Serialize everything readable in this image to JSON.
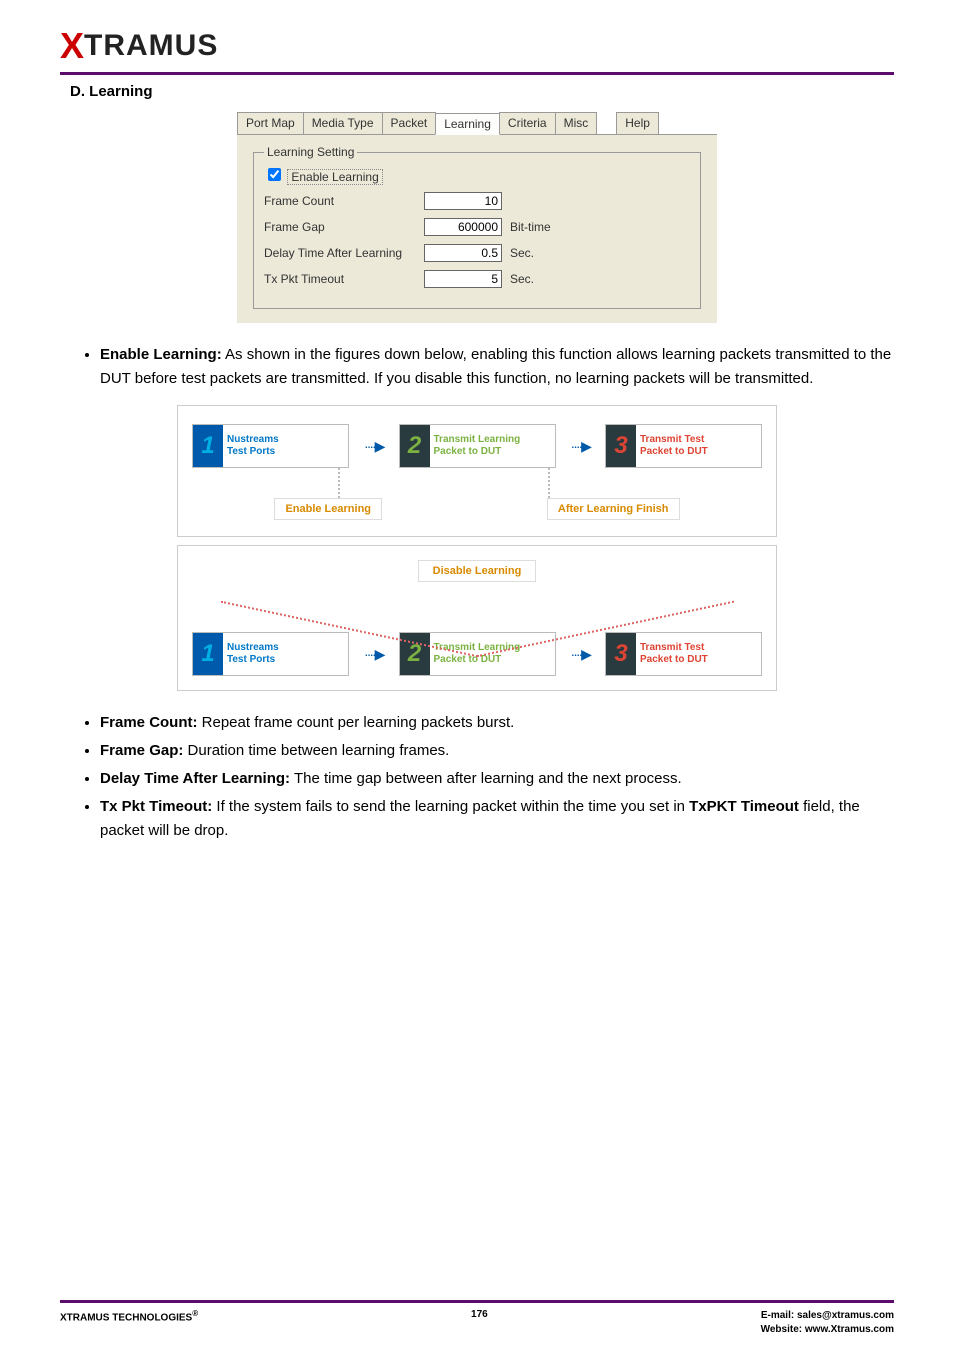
{
  "logo": {
    "x": "X",
    "rest": "TRAMUS"
  },
  "section_title": "D. Learning",
  "tabs": {
    "port_map": "Port Map",
    "media_type": "Media Type",
    "packet": "Packet",
    "learning": "Learning",
    "criteria": "Criteria",
    "misc": "Misc",
    "help": "Help"
  },
  "learning_panel": {
    "legend": "Learning Setting",
    "enable_learning_label": "Enable Learning",
    "frame_count_label": "Frame Count",
    "frame_count_value": "10",
    "frame_gap_label": "Frame Gap",
    "frame_gap_value": "600000",
    "frame_gap_unit": "Bit-time",
    "delay_label": "Delay Time After Learning",
    "delay_value": "0.5",
    "delay_unit": "Sec.",
    "tx_timeout_label": "Tx Pkt Timeout",
    "tx_timeout_value": "5",
    "tx_timeout_unit": "Sec."
  },
  "flow": {
    "box1_line1": "Nustreams",
    "box1_line2": "Test Ports",
    "box2_line1": "Transmit Learning",
    "box2_line2": "Packet to DUT",
    "box3_line1": "Transmit Test",
    "box3_line2": "Packet to DUT",
    "cap_enable": "Enable Learning",
    "cap_after": "After Learning Finish",
    "cap_disable": "Disable Learning",
    "arrow": "····▶",
    "n1": "1",
    "n2": "2",
    "n3": "3"
  },
  "bullets": {
    "b1_title": "Enable Learning:",
    "b1_text": " As shown in the figures down below, enabling this function allows learning packets transmitted to the DUT before test packets are transmitted. If you disable this function, no learning packets will be transmitted.",
    "b2_title": "Frame Count:",
    "b2_text": " Repeat frame count per learning packets burst.",
    "b3_title": "Frame Gap:",
    "b3_text": " Duration time between learning frames.",
    "b4_title": "Delay Time After Learning:",
    "b4_text": " The time gap between after learning and the next process.",
    "b5_title": "Tx Pkt Timeout:",
    "b5_text_a": " If the system fails to send the learning packet within the time you set in ",
    "b5_bold": "TxPKT Timeout",
    "b5_text_b": " field, the packet will be drop."
  },
  "footer": {
    "company": "XTRAMUS TECHNOLOGIES",
    "reg": "®",
    "page": "176",
    "email_label": "E-mail: ",
    "email": "sales@xtramus.com",
    "website_label": "Website:  ",
    "website": "www.Xtramus.com"
  }
}
